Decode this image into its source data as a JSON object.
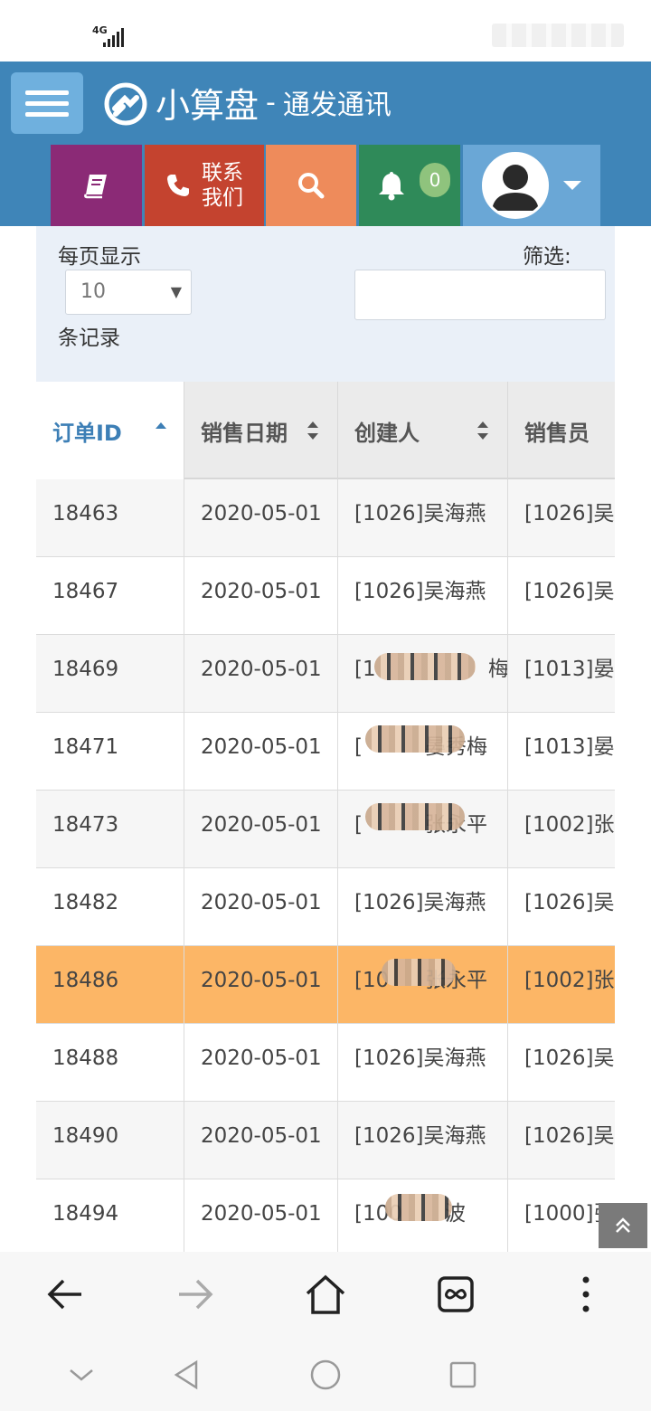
{
  "status_bar": {
    "network": "4G"
  },
  "header": {
    "app_name": "小算盘",
    "separator": "-",
    "company": "通发通讯"
  },
  "toolbar": {
    "book_icon": "book-icon",
    "contact_line1": "联系",
    "contact_line2": "我们",
    "notification_count": "0"
  },
  "filters": {
    "per_page_label": "每页显示",
    "per_page_value": "10",
    "records_label": "条记录",
    "filter_label": "筛选:",
    "filter_value": ""
  },
  "table": {
    "headers": [
      "订单ID",
      "销售日期",
      "创建人",
      "销售员"
    ],
    "rows": [
      {
        "id": "18463",
        "date": "2020-05-01",
        "creator": "[1026]吴海燕",
        "seller": "[1026]吴"
      },
      {
        "id": "18467",
        "date": "2020-05-01",
        "creator": "[1026]吴海燕",
        "seller": "[1026]吴"
      },
      {
        "id": "18469",
        "date": "2020-05-01",
        "creator": "[1",
        "creator_tail": "梅",
        "seller": "[1013]晏"
      },
      {
        "id": "18471",
        "date": "2020-05-01",
        "creator": "[",
        "creator_tail": "晏秀梅",
        "seller": "[1013]晏"
      },
      {
        "id": "18473",
        "date": "2020-05-01",
        "creator": "[",
        "creator_tail": "张永平",
        "seller": "[1002]张"
      },
      {
        "id": "18482",
        "date": "2020-05-01",
        "creator": "[1026]吴海燕",
        "seller": "[1026]吴"
      },
      {
        "id": "18486",
        "date": "2020-05-01",
        "creator": "[10",
        "creator_tail": "张永平",
        "seller": "[1002]张"
      },
      {
        "id": "18488",
        "date": "2020-05-01",
        "creator": "[1026]吴海燕",
        "seller": "[1026]吴"
      },
      {
        "id": "18490",
        "date": "2020-05-01",
        "creator": "[1026]吴海燕",
        "seller": "[1026]吴"
      },
      {
        "id": "18494",
        "date": "2020-05-01",
        "creator": "[100",
        "creator_tail": "波",
        "seller": "[1000]张"
      }
    ]
  },
  "colors": {
    "header_bg": "#3f85b8",
    "book_btn": "#8b2a76",
    "contact_btn": "#c4432f",
    "search_btn": "#ee8b5b",
    "bell_btn": "#2f8a59",
    "user_btn": "#6aa7d6",
    "highlight_row": "#fcb666",
    "active_header": "#3d7fb6"
  }
}
